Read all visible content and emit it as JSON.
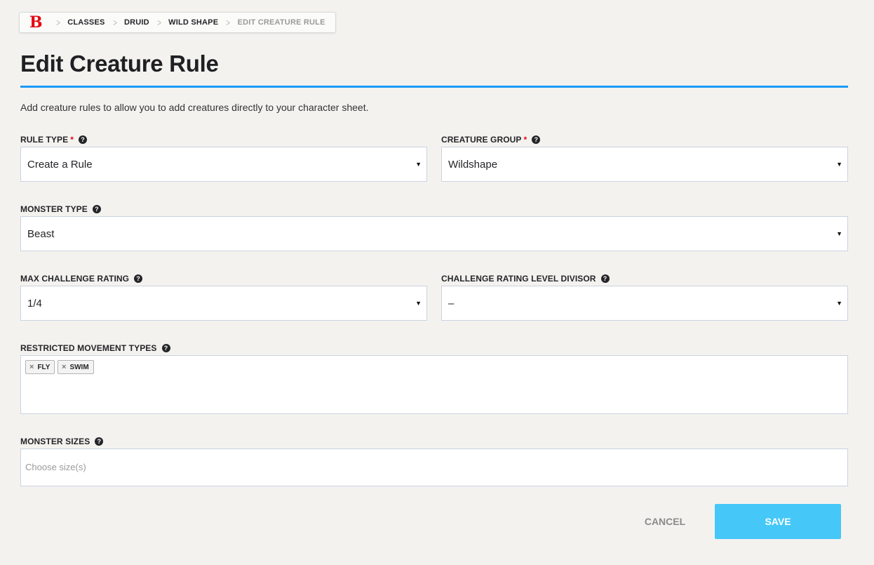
{
  "breadcrumb": {
    "logo": "B",
    "items": [
      "CLASSES",
      "DRUID",
      "WILD SHAPE",
      "EDIT CREATURE RULE"
    ]
  },
  "page": {
    "title": "Edit Creature Rule",
    "description": "Add creature rules to allow you to add creatures directly to your character sheet."
  },
  "fields": {
    "rule_type": {
      "label": "RULE TYPE",
      "required": "*",
      "value": "Create a Rule"
    },
    "creature_group": {
      "label": "CREATURE GROUP",
      "required": "*",
      "value": "Wildshape"
    },
    "monster_type": {
      "label": "MONSTER TYPE",
      "value": "Beast"
    },
    "max_cr": {
      "label": "MAX CHALLENGE RATING",
      "value": "1/4"
    },
    "cr_divisor": {
      "label": "CHALLENGE RATING LEVEL DIVISOR",
      "value": "–"
    },
    "movement": {
      "label": "RESTRICTED MOVEMENT TYPES",
      "tags": [
        "FLY",
        "SWIM"
      ]
    },
    "sizes": {
      "label": "MONSTER SIZES",
      "placeholder": "Choose size(s)"
    }
  },
  "actions": {
    "cancel": "CANCEL",
    "save": "SAVE"
  },
  "icons": {
    "help": "?",
    "caret": "▼",
    "remove": "×"
  },
  "colors": {
    "accent": "#1b9af7",
    "save_button": "#45c8f8",
    "brand_red": "#e40712"
  }
}
